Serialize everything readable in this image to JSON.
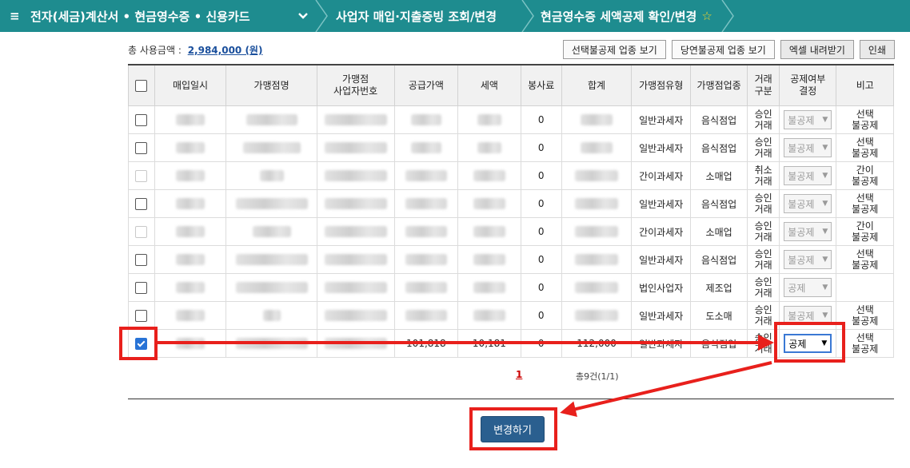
{
  "nav": {
    "menu_icon": "≡",
    "section": "전자(세금)계산서 • 현금영수증 • 신용카드",
    "chevron_icon": "chevron-down-icon",
    "crumb2": "사업자 매입·지출증빙 조회/변경",
    "crumb3": "현금영수증 세액공제 확인/변경",
    "star_icon": "☆"
  },
  "summary": {
    "label": "총 사용금액 :",
    "amount": "2,984,000 (원)"
  },
  "toolbar": {
    "btn_selective": "선택불공제 업종 보기",
    "btn_obvious": "당연불공제 업종 보기",
    "btn_excel": "엑셀 내려받기",
    "btn_print": "인쇄"
  },
  "table": {
    "headers": {
      "date": "매입일시",
      "merchant": "가맹점명",
      "biz_no_1": "가맹점",
      "biz_no_2": "사업자번호",
      "supply": "공급가액",
      "tax": "세액",
      "service": "봉사료",
      "total": "합계",
      "merchant_type": "가맹점유형",
      "industry": "가맹점업종",
      "trade_1": "거래",
      "trade_2": "구분",
      "deduct_1": "공제여부",
      "deduct_2": "결정",
      "note": "비고"
    },
    "rows": [
      {
        "service": "0",
        "type": "일반과세자",
        "industry": "음식점업",
        "trade_1": "승인",
        "trade_2": "거래",
        "deduct": "불공제",
        "note_1": "선택",
        "note_2": "불공제"
      },
      {
        "service": "0",
        "type": "일반과세자",
        "industry": "음식점업",
        "trade_1": "승인",
        "trade_2": "거래",
        "deduct": "불공제",
        "note_1": "선택",
        "note_2": "불공제"
      },
      {
        "service": "0",
        "type": "간이과세자",
        "industry": "소매업",
        "trade_1": "취소",
        "trade_2": "거래",
        "deduct": "불공제",
        "note_1": "간이",
        "note_2": "불공제"
      },
      {
        "service": "0",
        "type": "일반과세자",
        "industry": "음식점업",
        "trade_1": "승인",
        "trade_2": "거래",
        "deduct": "불공제",
        "note_1": "선택",
        "note_2": "불공제"
      },
      {
        "service": "0",
        "type": "간이과세자",
        "industry": "소매업",
        "trade_1": "승인",
        "trade_2": "거래",
        "deduct": "불공제",
        "note_1": "간이",
        "note_2": "불공제"
      },
      {
        "service": "0",
        "type": "일반과세자",
        "industry": "음식점업",
        "trade_1": "승인",
        "trade_2": "거래",
        "deduct": "불공제",
        "note_1": "선택",
        "note_2": "불공제"
      },
      {
        "service": "0",
        "type": "법인사업자",
        "industry": "제조업",
        "trade_1": "승인",
        "trade_2": "거래",
        "deduct": "공제",
        "note_1": "",
        "note_2": ""
      },
      {
        "service": "0",
        "type": "일반과세자",
        "industry": "도소매",
        "trade_1": "승인",
        "trade_2": "거래",
        "deduct": "불공제",
        "note_1": "선택",
        "note_2": "불공제"
      },
      {
        "supply": "101,818",
        "tax": "10,181",
        "service": "0",
        "total": "112,000",
        "type": "일반과세자",
        "industry": "음식점업",
        "trade_1": "승인",
        "trade_2": "거래",
        "deduct": "공제",
        "note_1": "선택",
        "note_2": "불공제"
      }
    ]
  },
  "pager": {
    "page": "1",
    "total": "총9건(1/1)"
  },
  "submit_label": "변경하기",
  "colors": {
    "topbar": "#1e8c8f",
    "annotation": "#e8201c",
    "submit": "#2a5f8f",
    "checkbox": "#2873d6"
  }
}
